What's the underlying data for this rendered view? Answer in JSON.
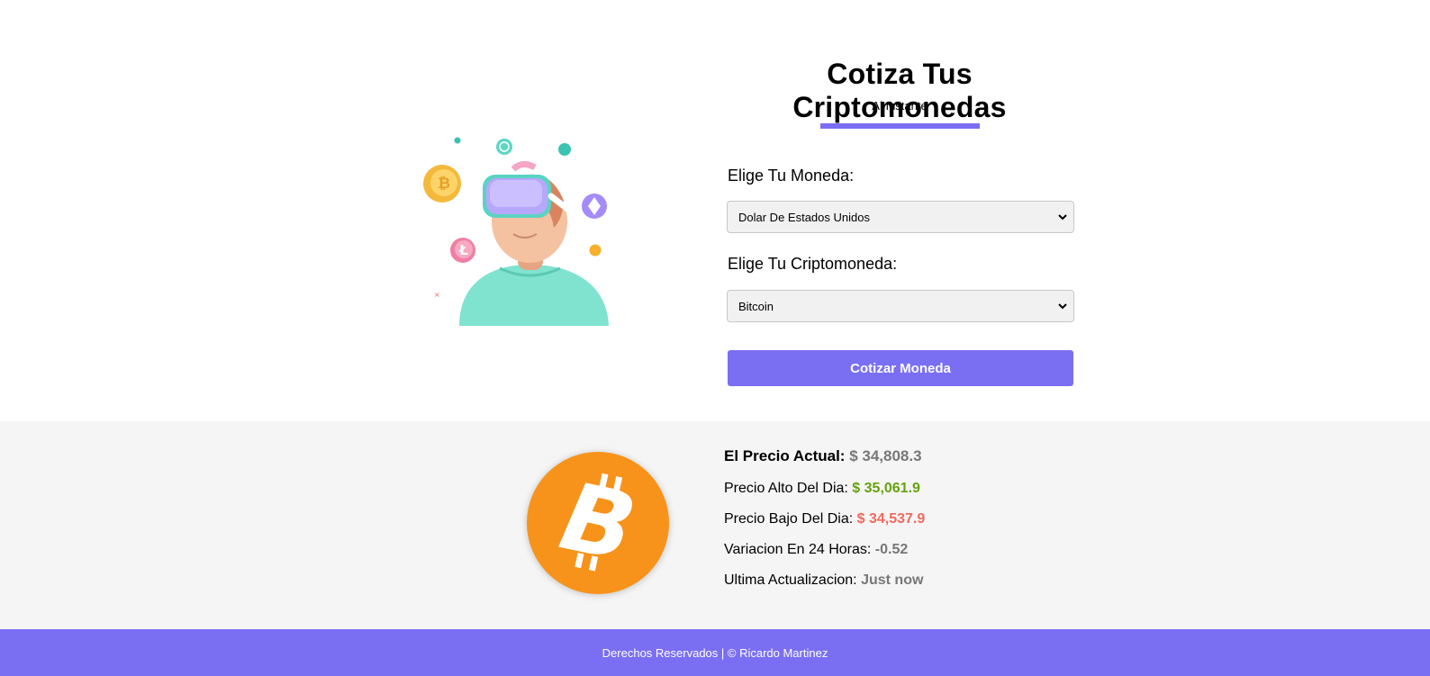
{
  "header": {
    "title": "Cotiza Tus Criptomonedas",
    "subtitle": "Al Instante"
  },
  "form": {
    "currency_label": "Elige Tu Moneda:",
    "currency_selected": "Dolar De Estados Unidos",
    "crypto_label": "Elige Tu Criptomoneda:",
    "crypto_selected": "Bitcoin",
    "submit_label": "Cotizar Moneda"
  },
  "quote": {
    "price_label": "El Precio Actual:",
    "price_value": "$ 34,808.3",
    "high_label": "Precio Alto Del Dia:",
    "high_value": "$ 35,061.9",
    "low_label": "Precio Bajo Del Dia:",
    "low_value": "$ 34,537.9",
    "change_label": "Variacion En 24 Horas:",
    "change_value": "-0.52",
    "updated_label": "Ultima Actualizacion:",
    "updated_value": "Just now"
  },
  "footer": {
    "text": "Derechos Reservados | © Ricardo Martinez"
  },
  "colors": {
    "accent": "#7a6ff2",
    "positive": "#65a30d",
    "negative": "#ef6a5c",
    "bitcoin": "#f7931a",
    "muted": "#777777"
  },
  "icons": {
    "hero": "vr-person-with-crypto-coins-illustration",
    "coin": "bitcoin-icon",
    "dropdown": "chevron-down-icon"
  }
}
